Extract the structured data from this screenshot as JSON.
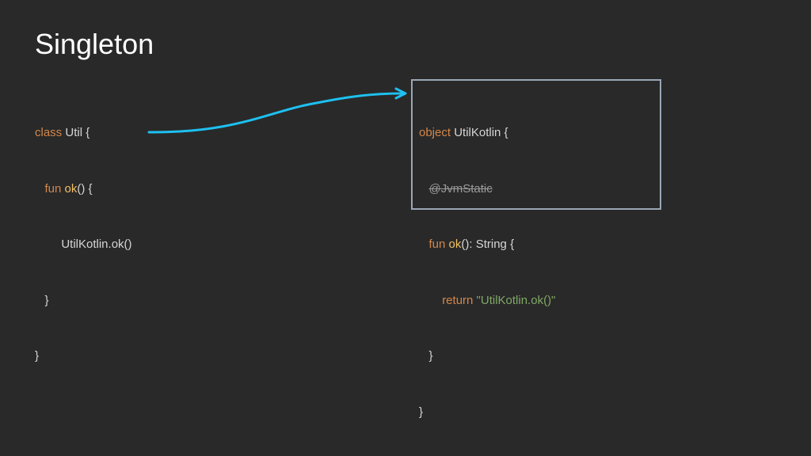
{
  "title": "Singleton",
  "left_code": {
    "l1_kw": "class",
    "l1_rest": " Util {",
    "l2_indent": "   ",
    "l2_kw": "fun",
    "l2_sp": " ",
    "l2_fn": "ok",
    "l2_rest": "() {",
    "l3": "        UtilKotlin.ok()",
    "l4": "   }",
    "l5": "}"
  },
  "right_code": {
    "l1_kw": "object",
    "l1_rest": " UtilKotlin {",
    "l2_indent": "   ",
    "l2_annotation": "@JvmStatic",
    "l3_indent": "   ",
    "l3_kw": "fun",
    "l3_sp": " ",
    "l3_fn": "ok",
    "l3_rest": "(): String {",
    "l4_indent": "       ",
    "l4_kw": "return",
    "l4_sp": " ",
    "l4_str": "\"UtilKotlin.ok()\"",
    "l5": "   }",
    "l6": "}"
  },
  "colors": {
    "background": "#292929",
    "keyword": "#d4874a",
    "function": "#f0c065",
    "string": "#7fa866",
    "arrow": "#1ec0f0",
    "box_border": "#9aa7b4"
  },
  "icons": {
    "arrow": "curved-arrow-icon"
  }
}
